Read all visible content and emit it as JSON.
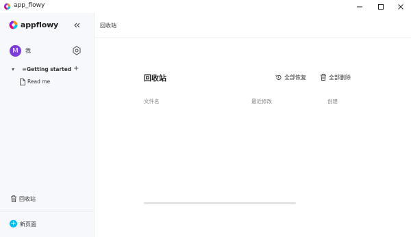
{
  "window": {
    "title": "app_flowy"
  },
  "sidebar": {
    "logo_text": "appflowy",
    "user": {
      "initial": "M",
      "name": "我"
    },
    "workspace": {
      "label": "Getting started"
    },
    "pages": [
      {
        "label": "Read me"
      }
    ],
    "trash_label": "回收站",
    "new_page_label": "新页面"
  },
  "topbar": {
    "breadcrumb": "回收站"
  },
  "trash": {
    "title": "回收站",
    "restore_all": "全部恢复",
    "delete_all": "全部删除",
    "columns": [
      "文件名",
      "最近修改",
      "创建"
    ]
  },
  "colors": {
    "accent": "#00bcf0",
    "avatar": "#7b3fd8",
    "sidebar_bg": "#f7f8fc"
  },
  "icons": [
    "appflowy-logo-icon",
    "collapse-sidebar-icon",
    "settings-icon",
    "document-icon",
    "trash-icon",
    "restore-icon",
    "add-icon",
    "minimize-icon",
    "maximize-icon",
    "close-icon"
  ]
}
